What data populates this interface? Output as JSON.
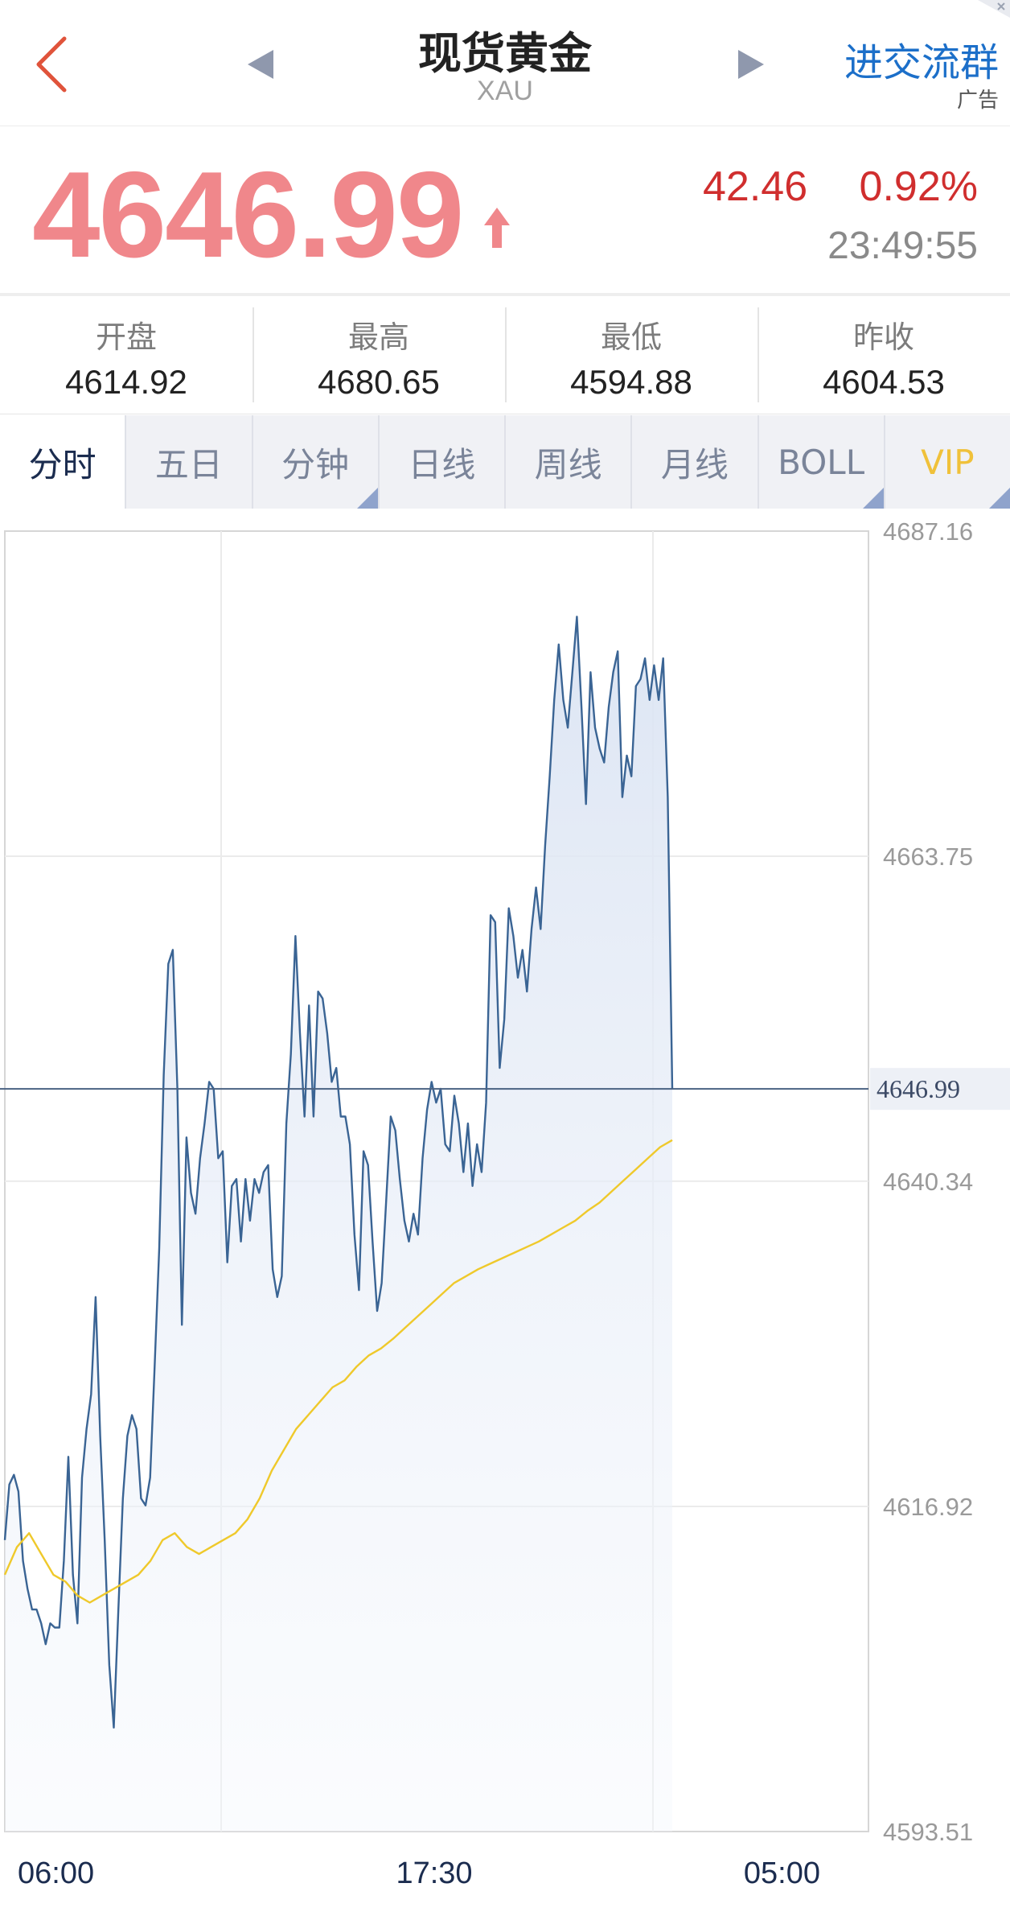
{
  "header": {
    "title": "现货黄金",
    "subtitle": "XAU",
    "group_link": "进交流群",
    "ad_label": "广告"
  },
  "quote": {
    "price": "4646.99",
    "change": "42.46",
    "change_pct": "0.92%",
    "time": "23:49:55"
  },
  "stats": [
    {
      "label": "开盘",
      "value": "4614.92"
    },
    {
      "label": "最高",
      "value": "4680.65"
    },
    {
      "label": "最低",
      "value": "4594.88"
    },
    {
      "label": "昨收",
      "value": "4604.53"
    }
  ],
  "tabs": [
    {
      "label": "分时"
    },
    {
      "label": "五日"
    },
    {
      "label": "分钟"
    },
    {
      "label": "日线"
    },
    {
      "label": "周线"
    },
    {
      "label": "月线"
    },
    {
      "label": "BOLL"
    },
    {
      "label": "VIP"
    }
  ],
  "colors": {
    "price": "#f0878b",
    "change": "#d02e2e",
    "link": "#1c6fc9",
    "price_line": "#3a6494",
    "avg_line": "#efc92b",
    "vip": "#f0c13a"
  },
  "chart_data": {
    "type": "line",
    "y_ticks": [
      "4687.16",
      "4663.75",
      "4640.34",
      "4616.92",
      "4593.51"
    ],
    "ylim": [
      4593.51,
      4687.16
    ],
    "x_ticks": [
      "06:00",
      "17:30",
      "05:00"
    ],
    "current_label": "4646.99",
    "current_value": 4646.99,
    "series": [
      {
        "role": "price",
        "values": [
          4614.5,
          4618.5,
          4619.2,
          4618.0,
          4613.0,
          4611.0,
          4609.5,
          4609.5,
          4608.5,
          4607.0,
          4608.5,
          4608.2,
          4608.2,
          4613.0,
          4620.5,
          4612.0,
          4608.5,
          4619.0,
          4622.5,
          4625.0,
          4632.0,
          4622.0,
          4614.5,
          4605.5,
          4601.0,
          4609.5,
          4617.5,
          4622.0,
          4623.5,
          4622.5,
          4617.5,
          4617.0,
          4619.0,
          4627.0,
          4635.5,
          4648.0,
          4656.0,
          4657.0,
          4647.0,
          4630.0,
          4643.5,
          4639.5,
          4638.0,
          4642.0,
          4644.5,
          4647.5,
          4647.0,
          4642.0,
          4642.5,
          4634.5,
          4640.0,
          4640.5,
          4636.0,
          4640.5,
          4637.5,
          4640.5,
          4639.5,
          4641.0,
          4641.5,
          4634.0,
          4632.0,
          4633.5,
          4644.5,
          4649.5,
          4658.0,
          4651.0,
          4645.0,
          4653.0,
          4645.0,
          4654.0,
          4653.5,
          4651.0,
          4647.5,
          4648.5,
          4645.0,
          4645.0,
          4643.0,
          4636.5,
          4632.5,
          4642.5,
          4641.5,
          4636.0,
          4631.0,
          4633.0,
          4639.0,
          4645.0,
          4644.0,
          4640.5,
          4637.5,
          4636.0,
          4638.0,
          4636.5,
          4642.0,
          4645.5,
          4647.5,
          4646.0,
          4647.0,
          4643.0,
          4642.5,
          4646.5,
          4644.5,
          4641.0,
          4644.5,
          4640.0,
          4643.0,
          4641.0,
          4646.0,
          4659.5,
          4659.0,
          4648.5,
          4652.0,
          4660.0,
          4658.0,
          4655.0,
          4657.0,
          4654.0,
          4658.5,
          4661.5,
          4658.5,
          4664.5,
          4669.5,
          4675.0,
          4679.0,
          4675.0,
          4673.0,
          4677.0,
          4681.0,
          4674.5,
          4667.5,
          4677.0,
          4673.0,
          4671.5,
          4670.5,
          4674.5,
          4677.0,
          4678.5,
          4668.0,
          4671.0,
          4669.5,
          4676.0,
          4676.5,
          4678.0,
          4675.0,
          4677.5,
          4675.0,
          4678.0,
          4668.0,
          4647.0
        ],
        "color": "#3a6494"
      },
      {
        "role": "average",
        "values": [
          4612.0,
          4614.0,
          4615.0,
          4613.5,
          4612.0,
          4611.5,
          4610.5,
          4610.0,
          4610.5,
          4611.0,
          4611.5,
          4612.0,
          4613.0,
          4614.5,
          4615.0,
          4614.0,
          4613.5,
          4614.0,
          4614.5,
          4615.0,
          4616.0,
          4617.5,
          4619.5,
          4621.0,
          4622.5,
          4623.5,
          4624.5,
          4625.5,
          4626.0,
          4627.0,
          4627.8,
          4628.3,
          4629.0,
          4629.8,
          4630.6,
          4631.4,
          4632.2,
          4633.0,
          4633.5,
          4634.0,
          4634.4,
          4634.8,
          4635.2,
          4635.6,
          4636.0,
          4636.5,
          4637.0,
          4637.5,
          4638.2,
          4638.8,
          4639.6,
          4640.4,
          4641.2,
          4642.0,
          4642.8,
          4643.3
        ],
        "color": "#efc92b"
      }
    ]
  }
}
